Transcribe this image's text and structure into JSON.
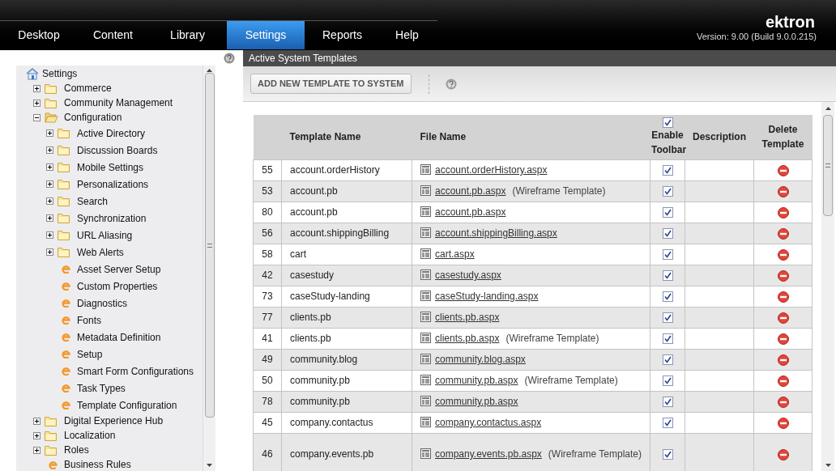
{
  "nav_tabs": [
    {
      "label": "Desktop",
      "selected": false
    },
    {
      "label": "Content",
      "selected": false
    },
    {
      "label": "Library",
      "selected": false
    },
    {
      "label": "Settings",
      "selected": true
    },
    {
      "label": "Reports",
      "selected": false
    },
    {
      "label": "Help",
      "selected": false
    }
  ],
  "brand": {
    "logo": "ektron",
    "version": "Version: 9.00 (Build 9.0.0.215)"
  },
  "tree": [
    {
      "label": "Settings",
      "kind": "root",
      "children": [
        {
          "label": "Commerce",
          "kind": "folder",
          "expanded": false
        },
        {
          "label": "Community Management",
          "kind": "folder",
          "expanded": false
        },
        {
          "label": "Configuration",
          "kind": "folder",
          "expanded": true,
          "children": [
            {
              "label": "Active Directory",
              "kind": "folder",
              "expanded": false
            },
            {
              "label": "Discussion Boards",
              "kind": "folder",
              "expanded": false
            },
            {
              "label": "Mobile Settings",
              "kind": "folder",
              "expanded": false
            },
            {
              "label": "Personalizations",
              "kind": "folder",
              "expanded": false
            },
            {
              "label": "Search",
              "kind": "folder",
              "expanded": false
            },
            {
              "label": "Synchronization",
              "kind": "folder",
              "expanded": false
            },
            {
              "label": "URL Aliasing",
              "kind": "folder",
              "expanded": false
            },
            {
              "label": "Web Alerts",
              "kind": "folder",
              "expanded": false
            },
            {
              "label": "Asset Server Setup",
              "kind": "page"
            },
            {
              "label": "Custom Properties",
              "kind": "page"
            },
            {
              "label": "Diagnostics",
              "kind": "page"
            },
            {
              "label": "Fonts",
              "kind": "page"
            },
            {
              "label": "Metadata Definition",
              "kind": "page"
            },
            {
              "label": "Setup",
              "kind": "page"
            },
            {
              "label": "Smart Form Configurations",
              "kind": "page"
            },
            {
              "label": "Task Types",
              "kind": "page"
            },
            {
              "label": "Template Configuration",
              "kind": "page"
            }
          ]
        },
        {
          "label": "Digital Experience Hub",
          "kind": "folder",
          "expanded": false
        },
        {
          "label": "Localization",
          "kind": "folder",
          "expanded": false
        },
        {
          "label": "Roles",
          "kind": "folder",
          "expanded": false
        },
        {
          "label": "Business Rules",
          "kind": "page"
        }
      ]
    }
  ],
  "panel": {
    "title": "Active System Templates",
    "add_button": "ADD NEW TEMPLATE TO SYSTEM"
  },
  "table": {
    "columns": [
      "Template Name",
      "File Name",
      "Enable Toolbar",
      "Description",
      "Delete Template"
    ],
    "header_toolbar_checked": true,
    "rows": [
      {
        "id": "55",
        "template_name": "account.orderHistory",
        "file_name": "account.orderHistory.aspx",
        "toolbar": true
      },
      {
        "id": "53",
        "template_name": "account.pb",
        "file_name": "account.pb.aspx",
        "note": "(Wireframe Template)",
        "toolbar": true
      },
      {
        "id": "80",
        "template_name": "account.pb",
        "file_name": "account.pb.aspx",
        "toolbar": true
      },
      {
        "id": "56",
        "template_name": "account.shippingBilling",
        "file_name": "account.shippingBilling.aspx",
        "toolbar": true
      },
      {
        "id": "58",
        "template_name": "cart",
        "file_name": "cart.aspx",
        "toolbar": true
      },
      {
        "id": "42",
        "template_name": "casestudy",
        "file_name": "casestudy.aspx",
        "toolbar": true
      },
      {
        "id": "73",
        "template_name": "caseStudy-landing",
        "file_name": "caseStudy-landing.aspx",
        "toolbar": true
      },
      {
        "id": "77",
        "template_name": "clients.pb",
        "file_name": "clients.pb.aspx",
        "toolbar": true
      },
      {
        "id": "41",
        "template_name": "clients.pb",
        "file_name": "clients.pb.aspx",
        "note": "(Wireframe Template)",
        "toolbar": true
      },
      {
        "id": "49",
        "template_name": "community.blog",
        "file_name": "community.blog.aspx",
        "toolbar": true
      },
      {
        "id": "50",
        "template_name": "community.pb",
        "file_name": "community.pb.aspx",
        "note": "(Wireframe Template)",
        "toolbar": true
      },
      {
        "id": "78",
        "template_name": "community.pb",
        "file_name": "community.pb.aspx",
        "toolbar": true
      },
      {
        "id": "45",
        "template_name": "company.contactus",
        "file_name": "company.contactus.aspx",
        "toolbar": true
      },
      {
        "id": "46",
        "template_name": "company.events.pb",
        "file_name": "company.events.pb.aspx",
        "note": "(Wireframe Template)",
        "toolbar": true
      }
    ]
  }
}
